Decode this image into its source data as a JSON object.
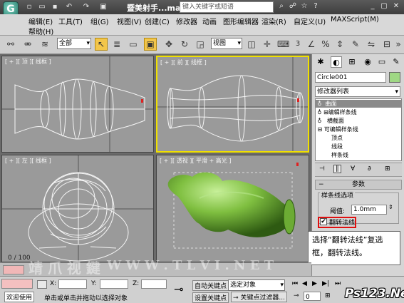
{
  "titlebar": {
    "logo": "G",
    "app_title": "暨美射手...max",
    "search_placeholder": "键入关键字或短语",
    "quick_icons": [
      "new-icon",
      "open-icon",
      "save-icon",
      "undo-icon",
      "redo-icon"
    ],
    "window_buttons": [
      "minimize-icon",
      "maximize-icon",
      "close-icon"
    ]
  },
  "menubar": {
    "items": [
      "编辑(E)",
      "工具(T)",
      "组(G)",
      "视图(V)",
      "创建(C)",
      "修改器",
      "动画",
      "图形编辑器",
      "渲染(R)",
      "自定义(U)",
      "MAXScript(M)"
    ],
    "row2": [
      "帮助(H)"
    ]
  },
  "toolbar": {
    "selection_filter": "全部",
    "reference_coord": "视图",
    "snap_value": "3"
  },
  "viewports": {
    "top": "[ + ][ 顶 ][ 线框 ]",
    "front": "[ + ][ 前 ][ 线框 ]",
    "left": "[ + ][ 左 ][ 线框 ]",
    "persp": "[ + ][ 透视 ][ 平滑 + 高光 ]"
  },
  "command_panel": {
    "object_name": "Circle001",
    "object_color": "#9fd884",
    "modifier_list": "修改器列表",
    "stack": [
      "曲面",
      "编辑样条线",
      "横截面",
      "可编辑样条线",
      "顶点",
      "线段",
      "样条线"
    ],
    "params_title": "参数",
    "spline_options": "样条线选项",
    "threshold_label": "阈值:",
    "threshold_value": "1.0mm",
    "flip_normals_label": "翻转法线",
    "flip_normals_checked": true
  },
  "callout": {
    "text": "选择“翻转法线”复选框，翻转法线。"
  },
  "timeline": {
    "frame": "0 / 100"
  },
  "status": {
    "welcome": "欢迎使用",
    "prompt": "单击或单击并拖动以选择对象",
    "x_label": "X:",
    "y_label": "Y:",
    "z_label": "Z:",
    "auto_key": "自动关键点",
    "set_key": "设置关键点",
    "selected_object": "选定对象",
    "key_filters": "关键点过滤器...",
    "frame_field": "0"
  },
  "watermarks": {
    "brand": "Ps123.Net",
    "left": "靖  爪  视  鍵",
    "center": "W  W  W . T L V I . N E T"
  },
  "colors": {
    "active_viewport_border": "#f0e000",
    "highlight_box": "#e01010",
    "object_green": "#7fbf40"
  }
}
